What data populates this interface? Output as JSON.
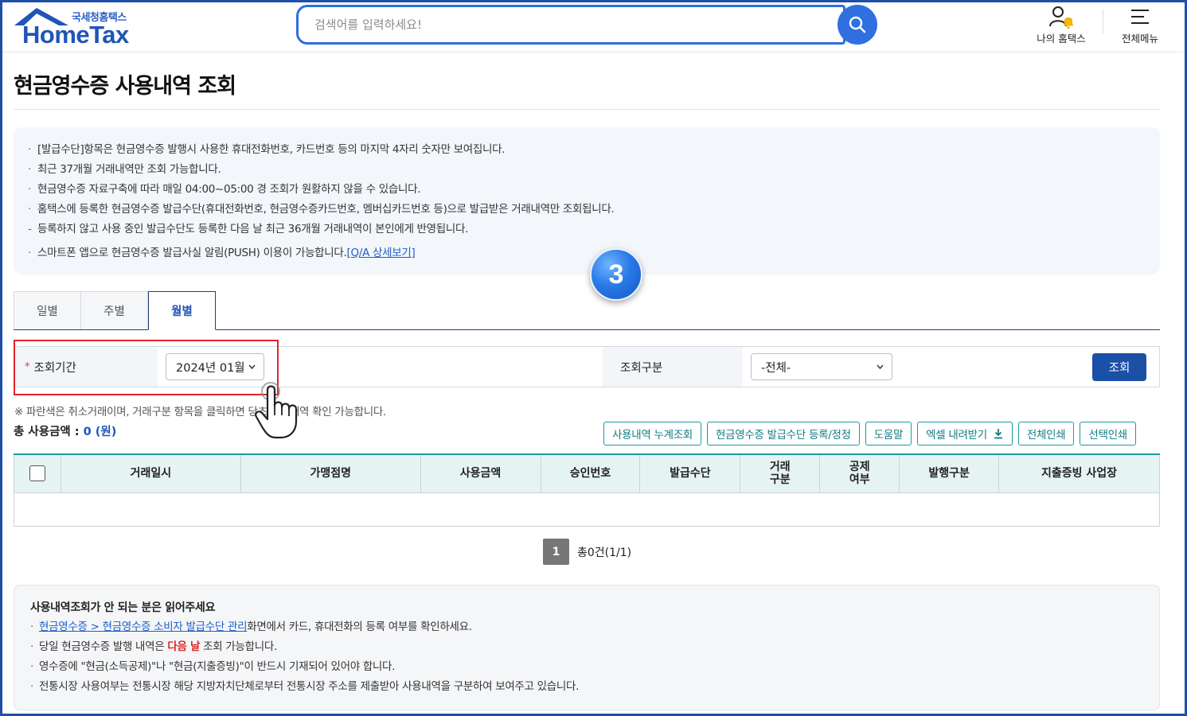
{
  "header": {
    "logo_sub": "국세청홈택스",
    "logo_main": "HomeTax",
    "search_placeholder": "검색어를 입력하세요!",
    "my_hometax": "나의 홈택스",
    "all_menu": "전체메뉴"
  },
  "page": {
    "title": "현금영수증 사용내역 조회"
  },
  "notice": {
    "items": [
      "[발급수단]항목은 현금영수증 발행시 사용한 휴대전화번호, 카드번호 등의 마지막 4자리 숫자만 보여집니다.",
      "최근 37개월 거래내역만 조회 가능합니다.",
      "현금영수증 자료구축에 따라 매일 04:00~05:00 경 조회가 원활하지 않을 수 있습니다.",
      "홈택스에 등록한 현금영수증 발급수단(휴대전화번호, 현금영수증카드번호, 멤버십카드번호 등)으로 발급받은 거래내역만 조회됩니다."
    ],
    "sub_item": "등록하지 않고 사용 중인 발급수단도 등록한 다음 날 최근 36개월 거래내역이 본인에게 반영됩니다.",
    "push_text": "스마트폰 앱으로 현금영수증 발급사실 알림(PUSH) 이용이 가능합니다.",
    "push_link": "[Q/A 상세보기]"
  },
  "step_badge": "3",
  "tabs": [
    {
      "label": "일별",
      "active": false
    },
    {
      "label": "주별",
      "active": false
    },
    {
      "label": "월별",
      "active": true
    }
  ],
  "form": {
    "period_label": "조회기간",
    "required_mark": "*",
    "period_value": "2024년 01월",
    "type_label": "조회구분",
    "type_value": "-전체-",
    "query_button": "조회"
  },
  "legend_note": "※ 파란색은 취소거래이며, 거래구분 항목을 클릭하면 당초 거래내역 확인 가능합니다.",
  "total": {
    "label": "총 사용금액 : ",
    "value": "0 (원)"
  },
  "actions": [
    "사용내역 누계조회",
    "현금영수증 발급수단 등록/정정",
    "도움말",
    "엑셀 내려받기",
    "전체인쇄",
    "선택인쇄"
  ],
  "table": {
    "columns": [
      "거래일시",
      "가맹점명",
      "사용금액",
      "승인번호",
      "발급수단",
      "거래\n구분",
      "공제\n여부",
      "발행구분",
      "지출증빙 사업장"
    ]
  },
  "pagination": {
    "current": "1",
    "total": "총0건(1/1)"
  },
  "help": {
    "title": "사용내역조회가 안 되는 분은 읽어주세요",
    "link": "현금영수증 > 현금영수증 소비자 발급수단 관리",
    "link_suffix": "화면에서 카드, 휴대전화의 등록 여부를 확인하세요.",
    "same_day_prefix": "당일 현금영수증 발행 내역은 ",
    "same_day_red": "다음 날",
    "same_day_suffix": " 조회 가능합니다.",
    "receipt_note": "영수증에 \"현금(소득공제)\"나 \"현금(지출증빙)\"이 반드시 기재되어 있어야 합니다.",
    "market_note": "전통시장 사용여부는 전통시장 해당 지방자치단체로부터 전통시장 주소를 제출받아 사용내역을 구분하여 보여주고 있습니다."
  },
  "colors": {
    "brand": "#1f55b8",
    "accent_teal": "#1b9aa0",
    "highlight_red": "#e0242a"
  }
}
